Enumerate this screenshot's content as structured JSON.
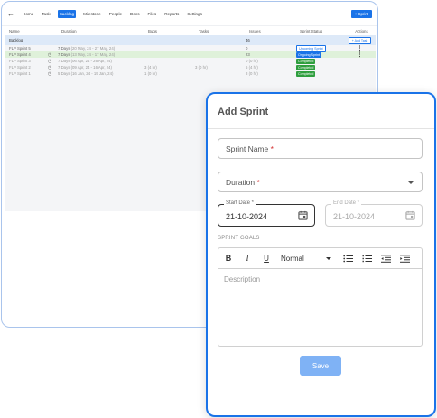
{
  "nav": {
    "items": [
      {
        "label": "Home"
      },
      {
        "label": "Task"
      },
      {
        "label": "Backlog"
      },
      {
        "label": "Milestone"
      },
      {
        "label": "People"
      },
      {
        "label": "Docs"
      },
      {
        "label": "Files"
      },
      {
        "label": "Reports"
      },
      {
        "label": "Settings"
      }
    ],
    "active_index": 2,
    "add_sprint_label": "+ Sprint"
  },
  "table": {
    "headers": {
      "name": "Name",
      "duration": "Duration",
      "bugs": "Bugs",
      "tasks": "Tasks",
      "issues": "Issues",
      "status": "Sprint Status",
      "actions": "Actions"
    },
    "backlog": {
      "name": "Backlog",
      "issues": "46",
      "action_label": "+ Add Task"
    },
    "rows": [
      {
        "name": "FLP Sprint 5",
        "days": "7 Days",
        "date": "(20 May, 24 - 27 May, 24)",
        "bugs": "",
        "tasks": "",
        "issues": "0",
        "status": "Upcoming Sprint",
        "status_kind": "upcoming"
      },
      {
        "name": "FLP Sprint 4",
        "days": "7 Days",
        "date": "(13 May, 24 - 17 May, 24)",
        "bugs": "",
        "tasks": "",
        "issues": "23",
        "status": "Ongoing Sprint",
        "status_kind": "ongoing"
      },
      {
        "name": "FLP Sprint 3",
        "days": "7 Days",
        "date": "(06 Apr, 24 - 26 Apr, 24)",
        "bugs": "",
        "tasks": "",
        "issues": "0 (0 hr)",
        "status": "Completed",
        "status_kind": "completed"
      },
      {
        "name": "FLP Sprint 2",
        "days": "7 Days",
        "date": "(09 Apr, 24 - 16 Apr, 24)",
        "bugs": "3 (4 hr)",
        "tasks": "3 (0 hr)",
        "issues": "6 (4 hr)",
        "status": "Completed",
        "status_kind": "completed"
      },
      {
        "name": "FLP Sprint 1",
        "days": "5 Days",
        "date": "(16 Jan, 24 - 19 Jan, 24)",
        "bugs": "1 (0 hr)",
        "tasks": "",
        "issues": "8 (0 hr)",
        "status": "Completed",
        "status_kind": "completed"
      }
    ]
  },
  "modal": {
    "title": "Add Sprint",
    "sprint_name_label": "Sprint Name",
    "duration_label": "Duration",
    "required_mark": "*",
    "start_date_label": "Start Date *",
    "start_date_value": "21-10-2024",
    "end_date_label": "End Date *",
    "end_date_value": "21-10-2024",
    "goals_label": "SPRINT GOALS",
    "toolbar": {
      "bold": "B",
      "italic": "I",
      "underline": "U",
      "format_value": "Normal"
    },
    "description_placeholder": "Description",
    "save_label": "Save"
  },
  "colors": {
    "accent": "#1a73e8",
    "completed": "#2e9e3e",
    "save_button": "#7fb2f5",
    "required": "#d32f2f"
  }
}
